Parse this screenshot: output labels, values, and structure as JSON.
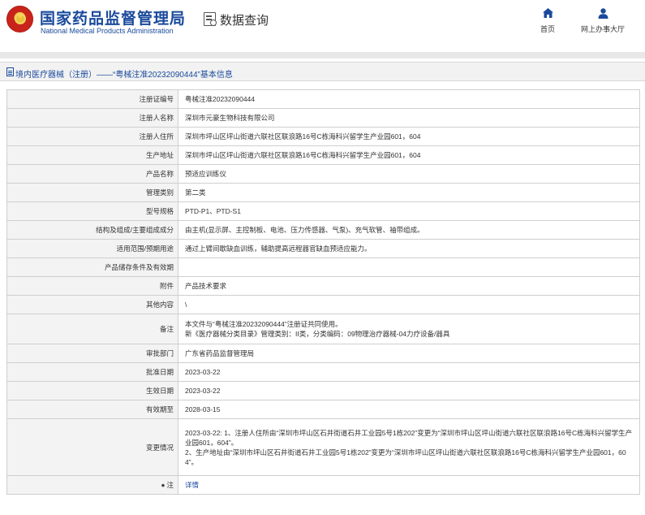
{
  "header": {
    "brand_cn": "国家药品监督管理局",
    "brand_en": "National Medical Products Administration",
    "page_title": "数据查询",
    "nav": [
      {
        "label": "首页",
        "icon": "home-icon"
      },
      {
        "label": "网上办事大厅",
        "icon": "user-icon"
      }
    ]
  },
  "breadcrumb": "境内医疗器械（注册）——“粤械注准20232090444”基本信息",
  "colors": {
    "brand_blue": "#1a4a9c",
    "label_bg": "#f3f3f3",
    "border": "#cfcfcf"
  },
  "rows": [
    {
      "label": "注册证编号",
      "value": "粤械注准20232090444"
    },
    {
      "label": "注册人名称",
      "value": "深圳市元豪生物科技有限公司"
    },
    {
      "label": "注册人住所",
      "value": "深圳市坪山区坪山街道六联社区联浪路16号C栋海科兴留学生产业园601，604"
    },
    {
      "label": "生产地址",
      "value": "深圳市坪山区坪山街道六联社区联浪路16号C栋海科兴留学生产业园601，604"
    },
    {
      "label": "产品名称",
      "value": "预适应训练仪"
    },
    {
      "label": "管理类别",
      "value": "第二类"
    },
    {
      "label": "型号规格",
      "value": "PTD-P1、PTD-S1"
    },
    {
      "label": "结构及组成/主要组成成分",
      "value": "由主机(显示屏、主控制板、电池、压力传感器、气泵)、充气软管、袖带组成。"
    },
    {
      "label": "适用范围/预期用途",
      "value": "通过上臂间歇缺血训练，辅助提高远程器官缺血预适应能力。"
    },
    {
      "label": "产品储存条件及有效期",
      "value": ""
    },
    {
      "label": "附件",
      "value": "产品技术要求"
    },
    {
      "label": "其他内容",
      "value": "\\"
    }
  ],
  "remark": {
    "label": "备注",
    "lines": [
      "本文件与“粤械注准20232090444”注册证共同使用。",
      "新《医疗器械分类目录》管理类别：II类，分类编码：09物理治疗器械-04力疗设备/器具"
    ]
  },
  "rows2": [
    {
      "label": "审批部门",
      "value": "广东省药品监督管理局"
    },
    {
      "label": "批准日期",
      "value": "2023-03-22"
    },
    {
      "label": "生效日期",
      "value": "2023-03-22"
    },
    {
      "label": "有效期至",
      "value": "2028-03-15"
    }
  ],
  "change": {
    "label": "变更情况",
    "para1": "2023-03-22: 1、注册人住所由“深圳市坪山区石井街道石井工业园5号1栋202”变更为“深圳市坪山区坪山街道六联社区联浪路16号C栋海科兴留学生产业园601，604”。",
    "para2": "2、生产地址由“深圳市坪山区石井街道石井工业园5号1栋202”变更为“深圳市坪山区坪山街道六联社区联浪路16号C栋海科兴留学生产业园601，604”。"
  },
  "footer_row": {
    "label": "注",
    "pin_icon": "pin-icon",
    "link": "详情"
  }
}
